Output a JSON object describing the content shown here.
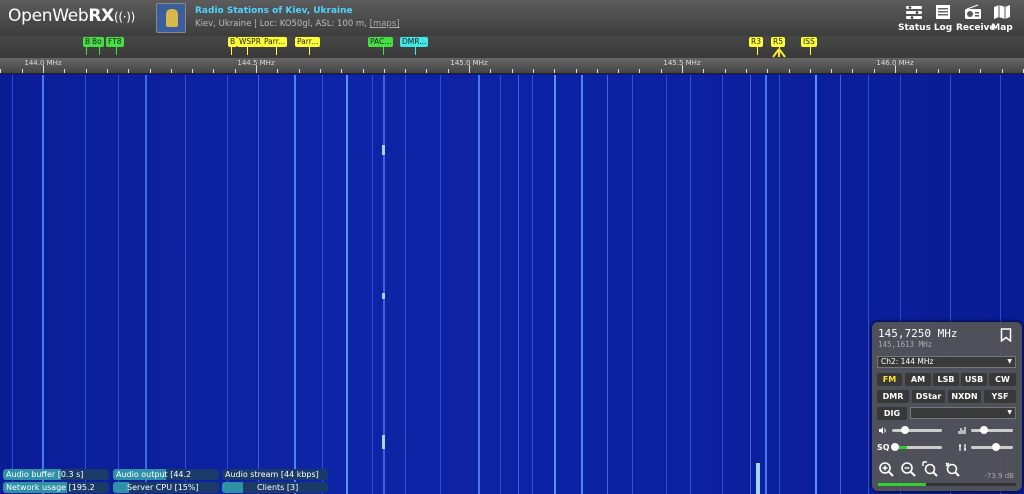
{
  "header": {
    "logo": {
      "text_open": "Open",
      "text_web": "Web",
      "text_rx": "RX"
    },
    "receiver_title": "Radio Stations of Kiev, Ukraine",
    "receiver_desc": "Kiev, Ukraine | Loc: KO50gl, ASL: 100 m,",
    "receiver_maps_link": "[maps]",
    "nav": [
      {
        "label": "Status",
        "icon": "status-icon"
      },
      {
        "label": "Log",
        "icon": "log-icon"
      },
      {
        "label": "Receive",
        "icon": "radio-icon"
      },
      {
        "label": "Map",
        "icon": "map-icon"
      }
    ]
  },
  "bookmarks": [
    {
      "label": "B",
      "color": "green"
    },
    {
      "label": "Bo",
      "color": "green"
    },
    {
      "label": "FT8",
      "color": "green"
    },
    {
      "label": "B",
      "color": "yellow"
    },
    {
      "label": "WSPR",
      "color": "yellow"
    },
    {
      "label": "Parr...",
      "color": "yellow"
    },
    {
      "label": "Parr...",
      "color": "yellow"
    },
    {
      "label": "PAC...",
      "color": "green"
    },
    {
      "label": "DMR...",
      "color": "cyan"
    },
    {
      "label": "R3",
      "color": "yellow"
    },
    {
      "label": "R5",
      "color": "yellow"
    },
    {
      "label": "ISS",
      "color": "yellow"
    }
  ],
  "scale": {
    "labels": [
      "144.0 MHz",
      "144.5 MHz",
      "145.0 MHz",
      "145.5 MHz",
      "146.0 MHz"
    ]
  },
  "status_bars": [
    {
      "label": "Audio buffer [0.3 s]",
      "fill": 0.55
    },
    {
      "label": "Audio output [44.2",
      "fill": 0.5
    },
    {
      "label": "Audio stream [44 kbps]",
      "fill": 0.0
    },
    {
      "label": "Network usage [195.2",
      "fill": 0.6
    },
    {
      "label": "Server CPU [15%]",
      "fill": 0.15
    },
    {
      "label": "Clients [3]",
      "fill": 0.2
    }
  ],
  "panel": {
    "frequency": "145,7250 MHz",
    "offset_frequency": "145,1613 MHz",
    "profile": "Ch2: 144 MHz",
    "modes_row1": [
      "FM",
      "AM",
      "LSB",
      "USB",
      "CW"
    ],
    "modes_row2": [
      "DMR",
      "DStar",
      "NXDN",
      "YSF"
    ],
    "active_mode": "FM",
    "dig_label": "DIG",
    "sliders": {
      "volume": 0.25,
      "squelch": 0.05,
      "nr": 0.3,
      "agc": 0.6
    },
    "slider_labels": {
      "squelch": "SQ"
    },
    "smeter_value": "-73.9 dB",
    "smeter_fill": 0.35
  },
  "colors": {
    "accent_cyan": "#4fd3ff",
    "bookmark_green": "#44e044",
    "bookmark_yellow": "#ffff33",
    "bookmark_cyan": "#40e8e8",
    "active_mode": "#ffe72b"
  }
}
